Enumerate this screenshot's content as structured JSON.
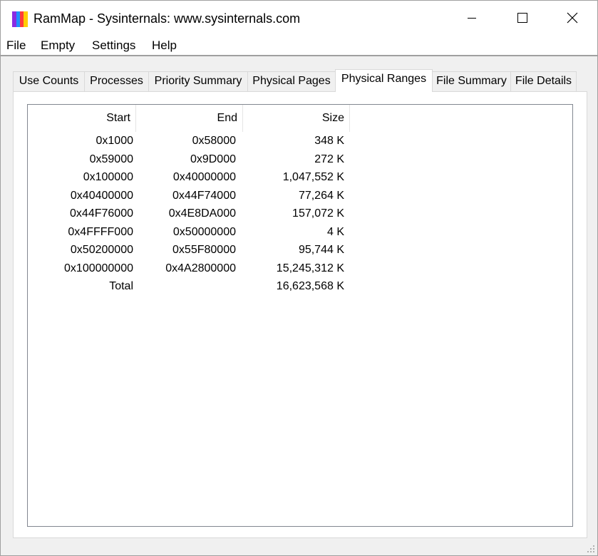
{
  "window": {
    "title": "RamMap - Sysinternals: www.sysinternals.com",
    "app_icon": "rammap-icon",
    "icon_colors": [
      "#8a2be2",
      "#1e90ff",
      "#ff3b3b",
      "#ffcc00"
    ]
  },
  "caption": {
    "minimize_icon": "minimize-icon",
    "maximize_icon": "maximize-icon",
    "close_icon": "close-icon"
  },
  "menu": {
    "file": "File",
    "empty": "Empty",
    "settings": "Settings",
    "help": "Help"
  },
  "tabs": [
    {
      "label": "Use Counts",
      "active": false
    },
    {
      "label": "Processes",
      "active": false
    },
    {
      "label": "Priority Summary",
      "active": false
    },
    {
      "label": "Physical Pages",
      "active": false
    },
    {
      "label": "Physical Ranges",
      "active": true
    },
    {
      "label": "File Summary",
      "active": false
    },
    {
      "label": "File Details",
      "active": false
    }
  ],
  "table": {
    "columns": [
      "Start",
      "End",
      "Size"
    ],
    "rows": [
      [
        "0x1000",
        "0x58000",
        "348 K"
      ],
      [
        "0x59000",
        "0x9D000",
        "272 K"
      ],
      [
        "0x100000",
        "0x40000000",
        "1,047,552 K"
      ],
      [
        "0x40400000",
        "0x44F74000",
        "77,264 K"
      ],
      [
        "0x44F76000",
        "0x4E8DA000",
        "157,072 K"
      ],
      [
        "0x4FFFF000",
        "0x50000000",
        "4 K"
      ],
      [
        "0x50200000",
        "0x55F80000",
        "95,744 K"
      ],
      [
        "0x100000000",
        "0x4A2800000",
        "15,245,312 K"
      ],
      [
        "Total",
        "",
        "16,623,568 K"
      ]
    ]
  }
}
